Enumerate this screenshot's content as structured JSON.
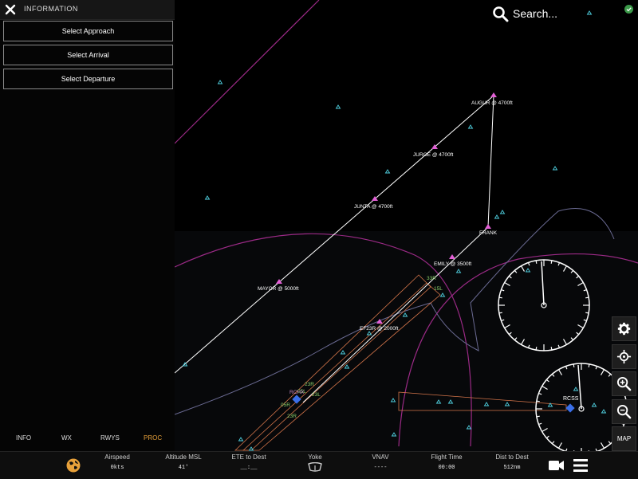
{
  "panel": {
    "title": "INFORMATION",
    "buttons": [
      "Select Approach",
      "Select Arrival",
      "Select Departure"
    ],
    "tabs": [
      "INFO",
      "WX",
      "RWYS",
      "PROC"
    ],
    "active_tab": "PROC"
  },
  "search": {
    "label": "Search..."
  },
  "map": {
    "waypoints": [
      {
        "label": "AUGUR @ 4700ft"
      },
      {
        "label": "JURGE @ 4700ft"
      },
      {
        "label": "JUNTA @ 4700ft"
      },
      {
        "label": "FRANK"
      },
      {
        "label": "EMILY @ 3500ft"
      },
      {
        "label": "MAYOR @ 5000ft"
      },
      {
        "label": "EF23R @ 2000ft"
      }
    ],
    "runway_labels": [
      "33R",
      "15L",
      "23R",
      "05L",
      "RCHX",
      "23L",
      "05R",
      "23R"
    ],
    "airport": "RCSS"
  },
  "controls": {
    "map_label": "MAP"
  },
  "status_bar": {
    "items": [
      {
        "label": "Airspeed",
        "value": "0kts"
      },
      {
        "label": "Altitude MSL",
        "value": "41'"
      },
      {
        "label": "ETE to Dest",
        "value": "__:__"
      },
      {
        "label": "Yoke",
        "value": ""
      },
      {
        "label": "VNAV",
        "value": "----"
      },
      {
        "label": "Flight Time",
        "value": "00:00"
      },
      {
        "label": "Dist to Dest",
        "value": "512nm"
      }
    ]
  },
  "colors": {
    "accent": "#e8a13a",
    "route": "#ffffff",
    "waypoint": "#e25fd5",
    "navaid": "#4fd0e0",
    "airspace": "#b0308f"
  }
}
